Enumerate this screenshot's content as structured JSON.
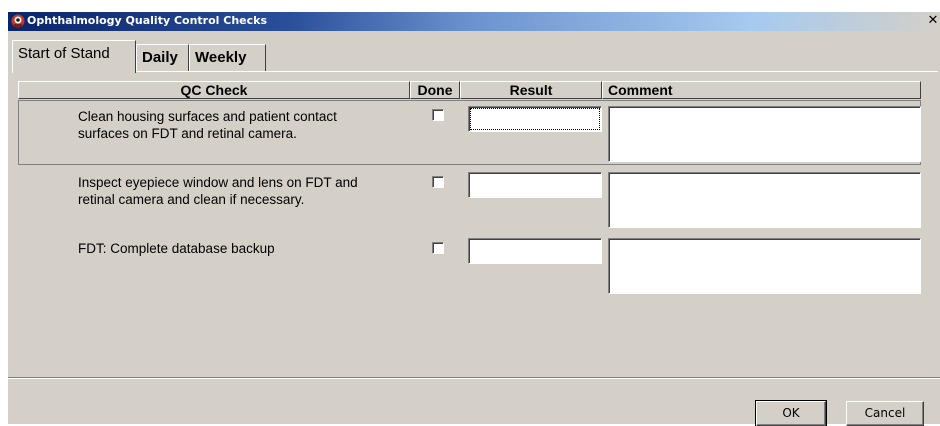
{
  "window": {
    "title": "Ophthalmology Quality Control Checks",
    "close_glyph": "✕",
    "icon": "ophthalmology-eye-icon"
  },
  "tabs": [
    {
      "label": "Start of Stand",
      "active": true
    },
    {
      "label": "Daily",
      "active": false
    },
    {
      "label": "Weekly",
      "active": false
    }
  ],
  "table": {
    "headers": {
      "qc_check": "QC Check",
      "done": "Done",
      "result": "Result",
      "comment": "Comment"
    },
    "rows": [
      {
        "line1": "Clean housing surfaces and patient contact",
        "line2": "surfaces on FDT and retinal camera.",
        "done": false,
        "result": "",
        "comment": ""
      },
      {
        "line1": "Inspect eyepiece window and lens on FDT and",
        "line2": "retinal camera and clean if necessary.",
        "done": false,
        "result": "",
        "comment": ""
      },
      {
        "line1": "FDT: Complete database backup",
        "line2": "",
        "done": false,
        "result": "",
        "comment": ""
      }
    ]
  },
  "buttons": {
    "ok": "OK",
    "cancel": "Cancel"
  },
  "colors": {
    "face": "#d4d0c8",
    "title_start": "#0a246a",
    "title_end": "#a6caf0"
  }
}
